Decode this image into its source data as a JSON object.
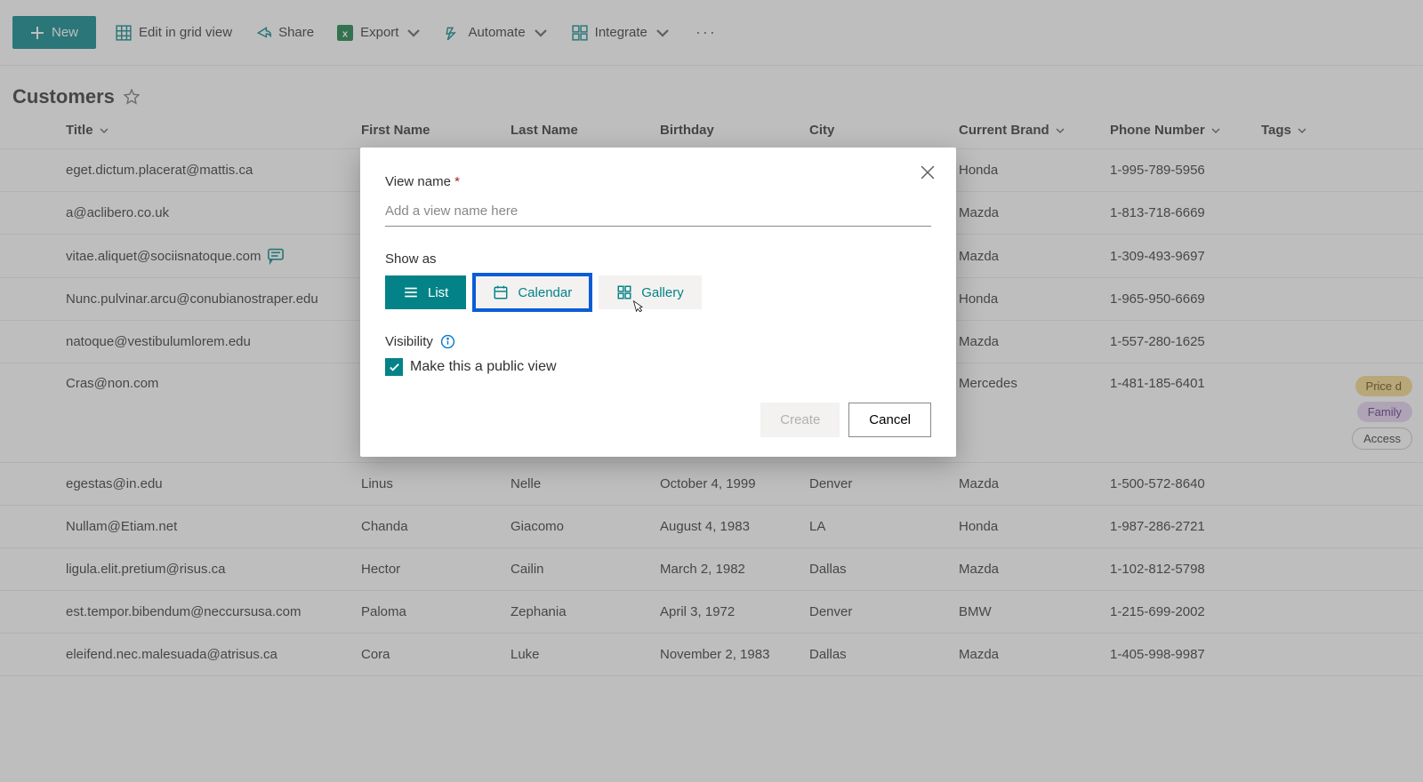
{
  "toolbar": {
    "new": "New",
    "editGrid": "Edit in grid view",
    "share": "Share",
    "export": "Export",
    "automate": "Automate",
    "integrate": "Integrate"
  },
  "page": {
    "title": "Customers"
  },
  "columns": {
    "title": "Title",
    "first": "First Name",
    "last": "Last Name",
    "birthday": "Birthday",
    "city": "City",
    "brand": "Current Brand",
    "phone": "Phone Number",
    "tags": "Tags"
  },
  "rows": [
    {
      "title": "eget.dictum.placerat@mattis.ca",
      "first": "",
      "last": "",
      "bd": "",
      "city": "",
      "brand": "Honda",
      "phone": "1-995-789-5956",
      "tags": [],
      "hasComment": false
    },
    {
      "title": "a@aclibero.co.uk",
      "first": "",
      "last": "",
      "bd": "",
      "city": "",
      "brand": "Mazda",
      "phone": "1-813-718-6669",
      "tags": [],
      "hasComment": false
    },
    {
      "title": "vitae.aliquet@sociisnatoque.com",
      "first": "",
      "last": "",
      "bd": "",
      "city": "",
      "brand": "Mazda",
      "phone": "1-309-493-9697",
      "tags": [],
      "hasComment": true
    },
    {
      "title": "Nunc.pulvinar.arcu@conubianostraper.edu",
      "first": "",
      "last": "",
      "bd": "",
      "city": "",
      "brand": "Honda",
      "phone": "1-965-950-6669",
      "tags": [],
      "hasComment": false
    },
    {
      "title": "natoque@vestibulumlorem.edu",
      "first": "",
      "last": "",
      "bd": "",
      "city": "",
      "brand": "Mazda",
      "phone": "1-557-280-1625",
      "tags": [],
      "hasComment": false
    },
    {
      "title": "Cras@non.com",
      "first": "",
      "last": "",
      "bd": "",
      "city": "",
      "brand": "Mercedes",
      "phone": "1-481-185-6401",
      "tags": [
        "Price d",
        "Family",
        "Access"
      ],
      "hasComment": false
    },
    {
      "title": "egestas@in.edu",
      "first": "Linus",
      "last": "Nelle",
      "bd": "October 4, 1999",
      "city": "Denver",
      "brand": "Mazda",
      "phone": "1-500-572-8640",
      "tags": [],
      "hasComment": false
    },
    {
      "title": "Nullam@Etiam.net",
      "first": "Chanda",
      "last": "Giacomo",
      "bd": "August 4, 1983",
      "city": "LA",
      "brand": "Honda",
      "phone": "1-987-286-2721",
      "tags": [],
      "hasComment": false
    },
    {
      "title": "ligula.elit.pretium@risus.ca",
      "first": "Hector",
      "last": "Cailin",
      "bd": "March 2, 1982",
      "city": "Dallas",
      "brand": "Mazda",
      "phone": "1-102-812-5798",
      "tags": [],
      "hasComment": false
    },
    {
      "title": "est.tempor.bibendum@neccursusa.com",
      "first": "Paloma",
      "last": "Zephania",
      "bd": "April 3, 1972",
      "city": "Denver",
      "brand": "BMW",
      "phone": "1-215-699-2002",
      "tags": [],
      "hasComment": false
    },
    {
      "title": "eleifend.nec.malesuada@atrisus.ca",
      "first": "Cora",
      "last": "Luke",
      "bd": "November 2, 1983",
      "city": "Dallas",
      "brand": "Mazda",
      "phone": "1-405-998-9987",
      "tags": [],
      "hasComment": false
    }
  ],
  "modal": {
    "viewNameLabel": "View name",
    "viewNamePlaceholder": "Add a view name here",
    "showAsLabel": "Show as",
    "optList": "List",
    "optCalendar": "Calendar",
    "optGallery": "Gallery",
    "visibilityLabel": "Visibility",
    "publicLabel": "Make this a public view",
    "create": "Create",
    "cancel": "Cancel"
  },
  "colors": {
    "teal": "#038387",
    "highlight": "#0b5cd6"
  }
}
